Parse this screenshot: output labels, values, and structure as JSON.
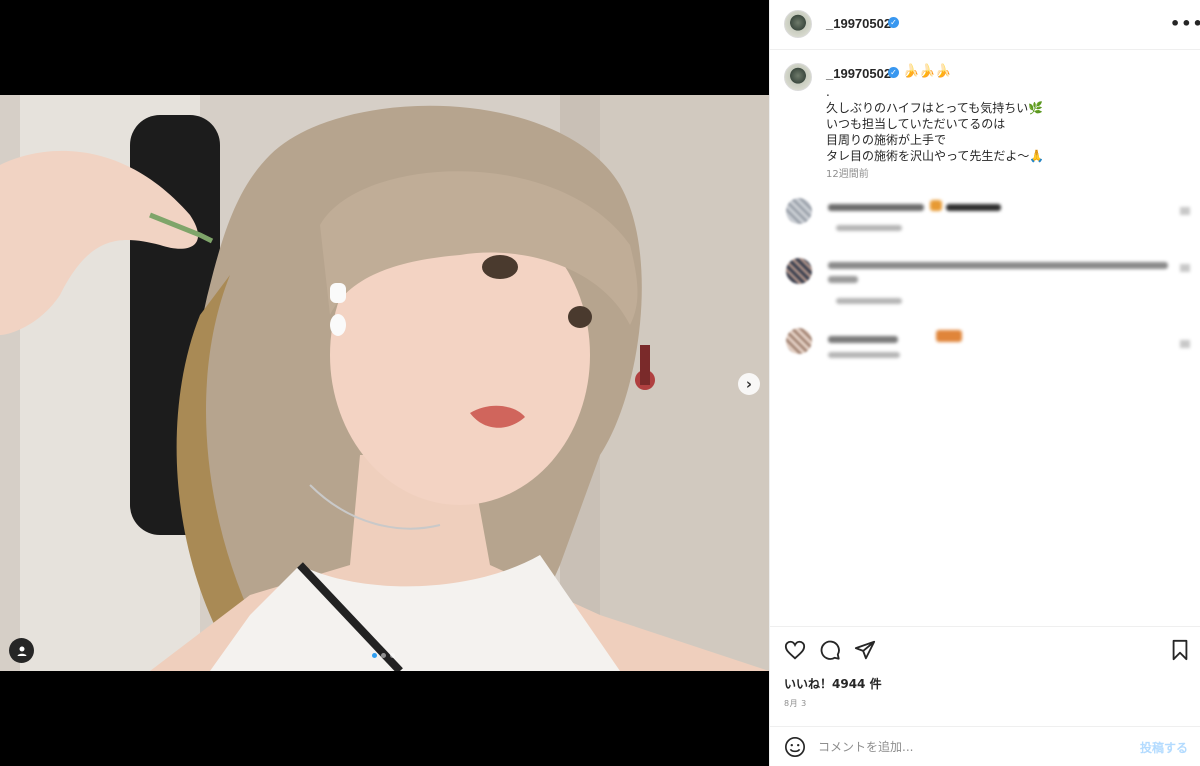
{
  "post": {
    "username": "_19970502",
    "more_label": "•••",
    "caption": {
      "emoji": "🍌🍌🍌",
      "lines": [
        ".",
        "久しぶりのハイフはとっても気持ちい🌿",
        "いつも担当していただいてるのは",
        "目周りの施術が上手で",
        "タレ目の施術を沢山やって先生だよ〜🙏"
      ]
    },
    "posted_ago": "12週間前",
    "likes_text": "いいね！4944 件",
    "date_text": "8月 3",
    "comment_placeholder": "コメントを追加...",
    "post_button_label": "投稿する"
  },
  "media": {
    "carousel_count": 3,
    "active_index": 0
  },
  "icons": {
    "heart": "heart-icon",
    "comment": "comment-icon",
    "share": "paper-plane-icon",
    "save": "bookmark-icon",
    "emoji": "smiley-icon",
    "next": "chevron-right-icon",
    "tag": "user-tag-icon"
  },
  "colors": {
    "verified": "#3897f0",
    "post_button": "#b3dbff",
    "muted_text": "#8e8e8e"
  }
}
